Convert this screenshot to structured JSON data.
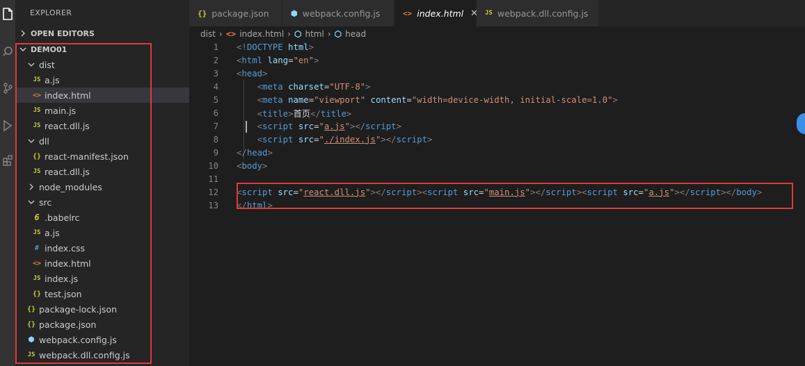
{
  "explorer": {
    "title": "EXPLORER",
    "open_editors": "OPEN EDITORS",
    "project": "DEMO01",
    "tree": [
      {
        "label": "dist",
        "kind": "folder",
        "open": true,
        "depth": 1
      },
      {
        "label": "a.js",
        "kind": "js",
        "depth": 2
      },
      {
        "label": "index.html",
        "kind": "html",
        "depth": 2,
        "active": true
      },
      {
        "label": "main.js",
        "kind": "js",
        "depth": 2
      },
      {
        "label": "react.dll.js",
        "kind": "js",
        "depth": 2
      },
      {
        "label": "dll",
        "kind": "folder",
        "open": true,
        "depth": 1
      },
      {
        "label": "react-manifest.json",
        "kind": "json",
        "depth": 2
      },
      {
        "label": "react.dll.js",
        "kind": "js",
        "depth": 2
      },
      {
        "label": "node_modules",
        "kind": "folder",
        "open": false,
        "depth": 1
      },
      {
        "label": "src",
        "kind": "folder",
        "open": true,
        "depth": 1
      },
      {
        "label": ".babelrc",
        "kind": "babel",
        "depth": 2
      },
      {
        "label": "a.js",
        "kind": "js",
        "depth": 2
      },
      {
        "label": "index.css",
        "kind": "css",
        "depth": 2
      },
      {
        "label": "index.html",
        "kind": "html",
        "depth": 2
      },
      {
        "label": "index.js",
        "kind": "js",
        "depth": 2
      },
      {
        "label": "test.json",
        "kind": "json",
        "depth": 2
      },
      {
        "label": "package-lock.json",
        "kind": "json",
        "depth": 1
      },
      {
        "label": "package.json",
        "kind": "json",
        "depth": 1
      },
      {
        "label": "webpack.config.js",
        "kind": "webpack",
        "depth": 1
      },
      {
        "label": "webpack.dll.config.js",
        "kind": "js",
        "depth": 1
      }
    ]
  },
  "tabs": [
    {
      "label": "package.json",
      "kind": "json"
    },
    {
      "label": "webpack.config.js",
      "kind": "webpack"
    },
    {
      "label": "index.html",
      "kind": "html",
      "active": true
    },
    {
      "label": "webpack.dll.config.js",
      "kind": "js"
    }
  ],
  "breadcrumb": {
    "items": [
      "dist",
      "index.html",
      "html",
      "head"
    ]
  },
  "code": {
    "lines": [
      [
        [
          "t",
          "<!"
        ],
        [
          "tn",
          "DOCTYPE"
        ],
        [
          "tx",
          " "
        ],
        [
          "an",
          "html"
        ],
        [
          "t",
          ">"
        ]
      ],
      [
        [
          "t",
          "<"
        ],
        [
          "tn",
          "html"
        ],
        [
          "tx",
          " "
        ],
        [
          "an",
          "lang"
        ],
        [
          "tx",
          "="
        ],
        [
          "av",
          "\"en\""
        ],
        [
          "t",
          ">"
        ]
      ],
      [
        [
          "t",
          "<"
        ],
        [
          "tn",
          "head"
        ],
        [
          "t",
          ">"
        ]
      ],
      [
        [
          "tx",
          "    "
        ],
        [
          "t",
          "<"
        ],
        [
          "tn",
          "meta"
        ],
        [
          "tx",
          " "
        ],
        [
          "an",
          "charset"
        ],
        [
          "tx",
          "="
        ],
        [
          "av",
          "\"UTF-8\""
        ],
        [
          "t",
          ">"
        ]
      ],
      [
        [
          "tx",
          "    "
        ],
        [
          "t",
          "<"
        ],
        [
          "tn",
          "meta"
        ],
        [
          "tx",
          " "
        ],
        [
          "an",
          "name"
        ],
        [
          "tx",
          "="
        ],
        [
          "av",
          "\"viewport\""
        ],
        [
          "tx",
          " "
        ],
        [
          "an",
          "content"
        ],
        [
          "tx",
          "="
        ],
        [
          "av",
          "\"width=device-width, initial-scale=1.0\""
        ],
        [
          "t",
          ">"
        ]
      ],
      [
        [
          "tx",
          "    "
        ],
        [
          "t",
          "<"
        ],
        [
          "tn",
          "title"
        ],
        [
          "t",
          ">"
        ],
        [
          "tx",
          "首页"
        ],
        [
          "t",
          "</"
        ],
        [
          "tn",
          "title"
        ],
        [
          "t",
          ">"
        ]
      ],
      [
        [
          "tx",
          "    "
        ],
        [
          "t",
          "<"
        ],
        [
          "tn",
          "script"
        ],
        [
          "tx",
          " "
        ],
        [
          "an",
          "src"
        ],
        [
          "tx",
          "="
        ],
        [
          "av",
          "\""
        ],
        [
          "avl",
          "a.js"
        ],
        [
          "av",
          "\""
        ],
        [
          "t",
          ">"
        ],
        [
          "t",
          "</"
        ],
        [
          "tn",
          "script"
        ],
        [
          "t",
          ">"
        ]
      ],
      [
        [
          "tx",
          "    "
        ],
        [
          "t",
          "<"
        ],
        [
          "tn",
          "script"
        ],
        [
          "tx",
          " "
        ],
        [
          "an",
          "src"
        ],
        [
          "tx",
          "="
        ],
        [
          "av",
          "\""
        ],
        [
          "avl",
          "./index.js"
        ],
        [
          "av",
          "\""
        ],
        [
          "t",
          ">"
        ],
        [
          "t",
          "</"
        ],
        [
          "tn",
          "script"
        ],
        [
          "t",
          ">"
        ]
      ],
      [
        [
          "t",
          "</"
        ],
        [
          "tn",
          "head"
        ],
        [
          "t",
          ">"
        ]
      ],
      [
        [
          "t",
          "<"
        ],
        [
          "tn",
          "body"
        ],
        [
          "t",
          ">"
        ]
      ],
      [],
      [
        [
          "t",
          "<"
        ],
        [
          "tn",
          "script"
        ],
        [
          "tx",
          " "
        ],
        [
          "an",
          "src"
        ],
        [
          "tx",
          "="
        ],
        [
          "av",
          "\""
        ],
        [
          "avl",
          "react.dll.js"
        ],
        [
          "av",
          "\""
        ],
        [
          "t",
          ">"
        ],
        [
          "t",
          "</"
        ],
        [
          "tn",
          "script"
        ],
        [
          "t",
          ">"
        ],
        [
          "t",
          "<"
        ],
        [
          "tn",
          "script"
        ],
        [
          "tx",
          " "
        ],
        [
          "an",
          "src"
        ],
        [
          "tx",
          "="
        ],
        [
          "av",
          "\""
        ],
        [
          "avl",
          "main.js"
        ],
        [
          "av",
          "\""
        ],
        [
          "t",
          ">"
        ],
        [
          "t",
          "</"
        ],
        [
          "tn",
          "script"
        ],
        [
          "t",
          ">"
        ],
        [
          "t",
          "<"
        ],
        [
          "tn",
          "script"
        ],
        [
          "tx",
          " "
        ],
        [
          "an",
          "src"
        ],
        [
          "tx",
          "="
        ],
        [
          "av",
          "\""
        ],
        [
          "avl",
          "a.js"
        ],
        [
          "av",
          "\""
        ],
        [
          "t",
          ">"
        ],
        [
          "t",
          "</"
        ],
        [
          "tn",
          "script"
        ],
        [
          "t",
          ">"
        ],
        [
          "t",
          "</"
        ],
        [
          "tn",
          "body"
        ],
        [
          "t",
          ">"
        ]
      ],
      [
        [
          "t",
          "</"
        ],
        [
          "tn",
          "html"
        ],
        [
          "t",
          ">"
        ]
      ]
    ]
  },
  "colors": {
    "highlight_box": "#e03b3b",
    "active_row": "#37373d"
  }
}
